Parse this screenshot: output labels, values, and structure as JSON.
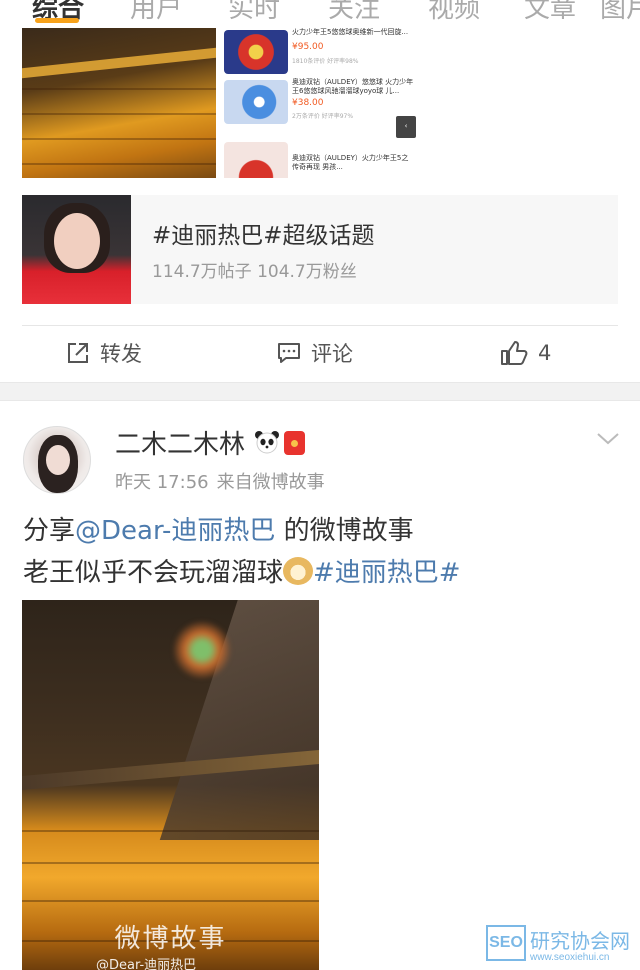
{
  "tabs": [
    "综合",
    "用户",
    "实时",
    "关注",
    "视频",
    "文章",
    "图片"
  ],
  "first_post": {
    "shop_items": [
      {
        "title": "火力少年王5悠悠球奥维新一代回旋...",
        "price": "¥95.00",
        "meta": "1810条评价 好评率98%"
      },
      {
        "title": "奥迪双钻（AULDEY）悠悠球 火力少年王6悠悠球风驰溜溜球yoyo球 儿...",
        "price": "¥38.00",
        "meta": "2万条评价 好评率97%"
      },
      {
        "title": "奥迪双钻（AULDEY）火力少年王5之传奇再现 男孩...",
        "price": "",
        "meta": ""
      }
    ],
    "topic": {
      "title": "#迪丽热巴#超级话题",
      "stats": "114.7万帖子 104.7万粉丝"
    },
    "actions": {
      "repost": "转发",
      "comment": "评论",
      "like_count": "4"
    }
  },
  "second_post": {
    "username": "二木二木林",
    "time": "昨天 17:56",
    "source": "来自微博故事",
    "content": {
      "prefix": "分享",
      "mention": "@Dear-迪丽热巴",
      "line1_rest": " 的微博故事",
      "line2": "老王似乎不会玩溜溜球",
      "hashtag": "#迪丽热巴#"
    },
    "video": {
      "watermark": "微博故事",
      "watermark_sub": "@Dear-迪丽热巴"
    }
  },
  "corner_watermark": {
    "box": "SEO",
    "text": "研究协会网",
    "url": "www.seoxiehui.cn"
  },
  "colors": {
    "link": "#4d7bad",
    "tab_accent": "#f7a21b",
    "price": "#f15a22"
  }
}
